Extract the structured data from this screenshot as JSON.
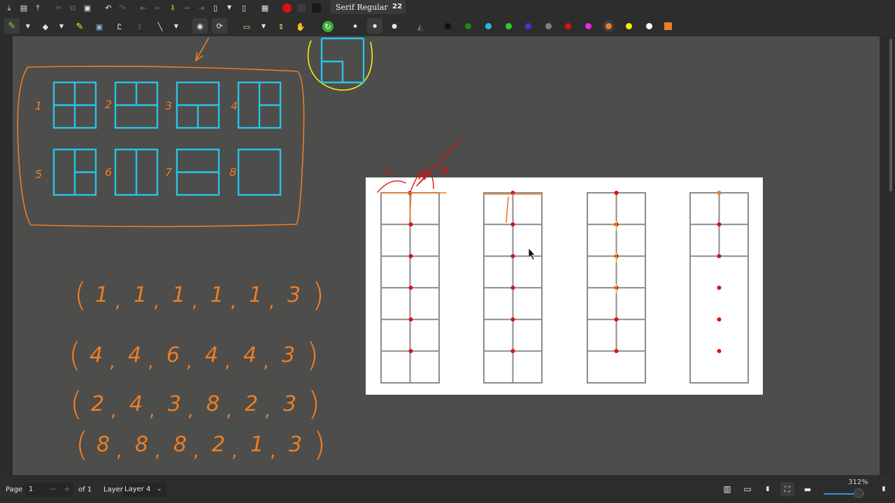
{
  "toolbar": {
    "font_name": "Serif Regular",
    "font_size": "22",
    "icons": [
      "save-icon",
      "new-page-icon",
      "export-icon",
      "cut-icon",
      "copy-icon",
      "paste-icon",
      "undo-icon",
      "redo-icon",
      "go-first-icon",
      "go-back-icon",
      "go-up-icon",
      "go-next-icon",
      "go-last-icon",
      "new-page-after-icon",
      "pdf-icon",
      "video-icon",
      "record-icon",
      "pause-icon",
      "stop-icon"
    ],
    "tools": [
      "pen-icon",
      "eraser-icon",
      "highlighter-icon",
      "image-icon",
      "text-icon",
      "latex-icon",
      "ruler-line-icon",
      "shape-recognizer-icon",
      "snap-icon",
      "select-rect-icon",
      "vertical-space-icon",
      "hand-icon",
      "refresh-icon",
      "dot-icon",
      "fill-icon"
    ],
    "colors": [
      "#111111",
      "#1a8c1a",
      "#2ab4e8",
      "#2ecc2e",
      "#3a3ad0",
      "#7f7f7f",
      "#e01010",
      "#e22ae2",
      "#ed7d24",
      "#f4ee10",
      "#ffffff"
    ],
    "selected_color": "#ed7d24"
  },
  "statusbar": {
    "page_label": "Page",
    "page_value": "1",
    "of_pages": "of 1",
    "layer_label": "Layer",
    "layer_value": "Layer 4",
    "zoom": "312%"
  },
  "canvas": {
    "figure_labels": [
      "1",
      "2",
      "3",
      "4",
      "5",
      "6",
      "7",
      "8"
    ],
    "sequences": [
      [
        "1",
        "1",
        "1",
        "1",
        "1",
        "3"
      ],
      [
        "4",
        "4",
        "6",
        "4",
        "4",
        "3"
      ],
      [
        "2",
        "4",
        "3",
        "8",
        "2",
        "3"
      ],
      [
        "8",
        "8",
        "8",
        "2",
        "1",
        "3"
      ]
    ],
    "arrow_labels": [
      "L",
      "N",
      "R"
    ]
  },
  "colors": {
    "ink": "#ed7d24",
    "cyan": "#29c4e6",
    "red": "#e01010",
    "yellow": "#f4ee10"
  }
}
